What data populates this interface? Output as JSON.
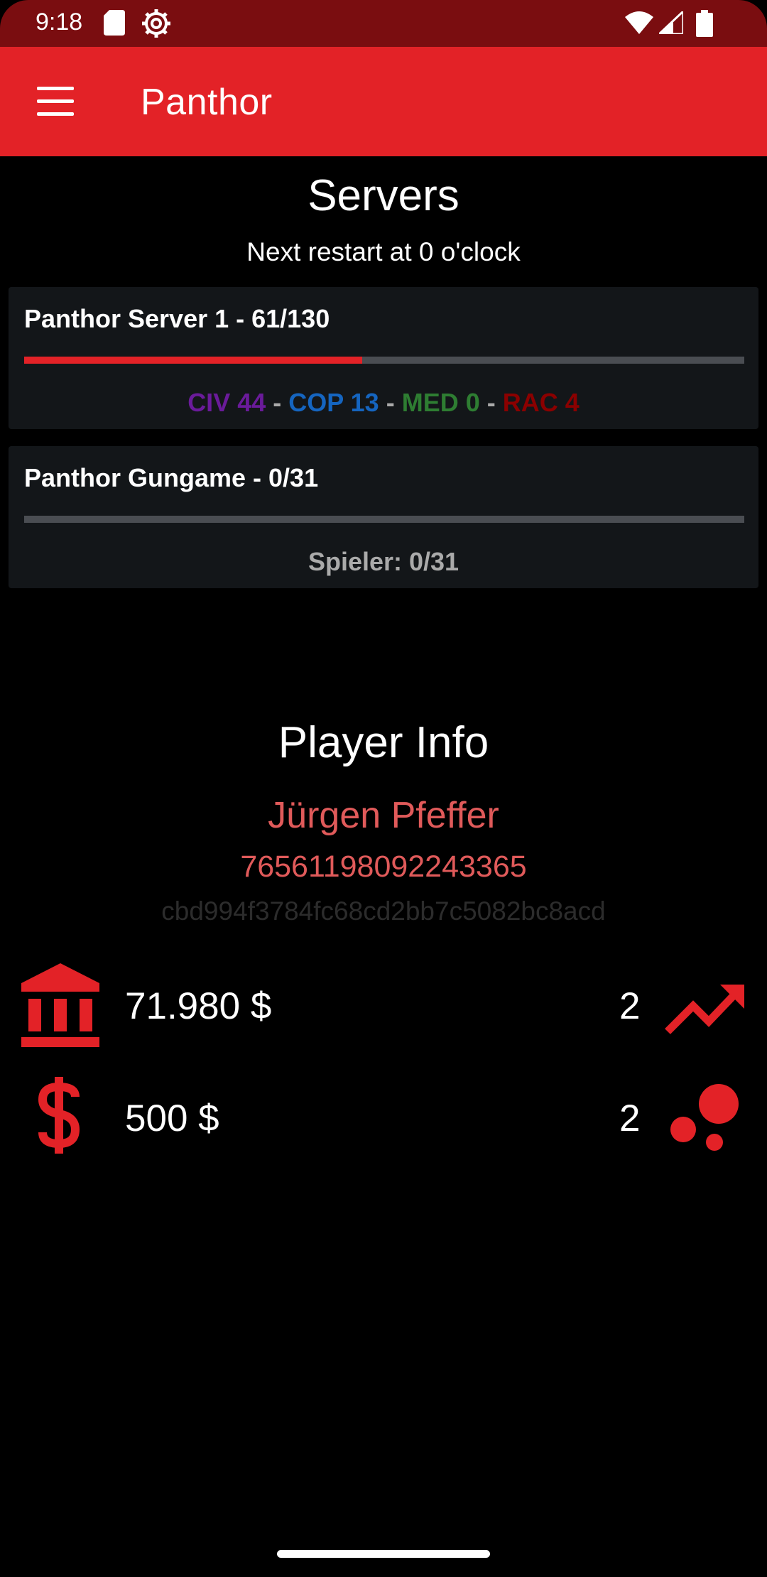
{
  "status_bar": {
    "time": "9:18",
    "icons": [
      "sd-card-icon",
      "settings-gear-icon",
      "wifi-icon",
      "signal-icon",
      "battery-icon"
    ]
  },
  "app_bar": {
    "title": "Panthor",
    "menu_icon": "hamburger-menu-icon",
    "color": "#e32227"
  },
  "servers": {
    "title": "Servers",
    "restart_text": "Next restart at 0 o'clock",
    "list": [
      {
        "name": "Panthor Server 1 - 61/130",
        "load_fraction": 0.469,
        "factions": [
          {
            "label": "CIV 44",
            "color": "#6a1b9a"
          },
          {
            "label": "COP 13",
            "color": "#1565c0"
          },
          {
            "label": "MED 0",
            "color": "#2e7d32"
          },
          {
            "label": "RAC 4",
            "color": "#8b0000"
          }
        ],
        "separator": "-"
      },
      {
        "name": "Panthor Gungame - 0/31",
        "load_fraction": 0,
        "summary": "Spieler: 0/31"
      }
    ]
  },
  "player_info": {
    "title": "Player Info",
    "name": "Jürgen Pfeffer",
    "steam_id": "76561198092243365",
    "hash": "cbd994f3784fc68cd2bb7c5082bc8acd",
    "stats": [
      {
        "icon": "bank-icon",
        "value": "71.980 $",
        "count": "2",
        "right_icon": "trending-up-icon"
      },
      {
        "icon": "dollar-icon",
        "value": "500 $",
        "count": "2",
        "right_icon": "bubbles-icon"
      }
    ]
  }
}
